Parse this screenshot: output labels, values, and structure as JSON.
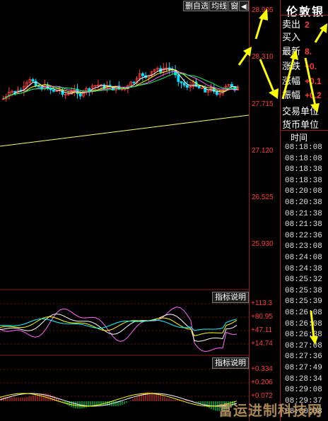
{
  "toolbar": {
    "self_select": "删自选",
    "avg_line": "均线",
    "window": "窗",
    "arrow": "◀|"
  },
  "price_axis": [
    "28.905",
    "28.310",
    "27.715",
    "27.120",
    "26.525",
    "25.930"
  ],
  "indicator1": {
    "button": "指标说明",
    "axis": [
      "+113.3",
      "+80.95",
      "+47.11",
      "+14.74"
    ]
  },
  "indicator2": {
    "button": "指标说明",
    "axis": [
      "+0.334",
      "+0.206",
      "+0.072"
    ]
  },
  "side": {
    "title": "伦敦银",
    "rows": [
      {
        "label": "卖出",
        "value": "2"
      },
      {
        "label": "买入",
        "value": ""
      },
      {
        "label": "最新",
        "value": "8."
      },
      {
        "label": "涨跌",
        "value": "+0."
      },
      {
        "label": "涨幅",
        "value": "+0.1"
      },
      {
        "label": "振幅",
        "value": "+0.2"
      },
      {
        "label": "交易单位",
        "value": ""
      },
      {
        "label": "货币单位",
        "value": ""
      }
    ],
    "time_header": "时间",
    "times": [
      "08:18:08",
      "08:18:08",
      "08:18:38",
      "08:18:38",
      "08:20:08",
      "08:20:38",
      "08:21:38",
      "08:21:38",
      "08:22:36",
      "08:23:08",
      "08:24:08",
      "08:24:38",
      "08:25:32",
      "08:25:38",
      "08:25:39",
      "08:26:08",
      "08:26:08",
      "08:26:38",
      "08:27:08",
      "08:27:36",
      "08:27:49",
      "08:28:34",
      "08:29:08",
      "08:29:37",
      "08:30:08"
    ]
  },
  "watermark": "富运进制科技网",
  "colors": {
    "grid": "#8a1a1a",
    "axis_text": "#ff3b3b",
    "up": "#ff3b3b",
    "down": "#00e0ff",
    "arrow": "#ffff00"
  }
}
